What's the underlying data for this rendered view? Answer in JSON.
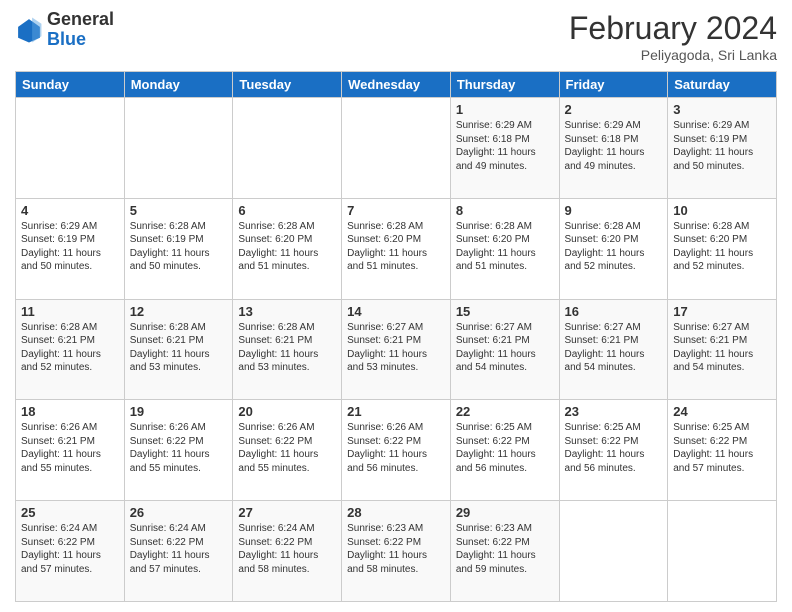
{
  "header": {
    "logo_general": "General",
    "logo_blue": "Blue",
    "month_title": "February 2024",
    "location": "Peliyagoda, Sri Lanka"
  },
  "weekdays": [
    "Sunday",
    "Monday",
    "Tuesday",
    "Wednesday",
    "Thursday",
    "Friday",
    "Saturday"
  ],
  "weeks": [
    [
      {
        "day": "",
        "info": ""
      },
      {
        "day": "",
        "info": ""
      },
      {
        "day": "",
        "info": ""
      },
      {
        "day": "",
        "info": ""
      },
      {
        "day": "1",
        "info": "Sunrise: 6:29 AM\nSunset: 6:18 PM\nDaylight: 11 hours and 49 minutes."
      },
      {
        "day": "2",
        "info": "Sunrise: 6:29 AM\nSunset: 6:18 PM\nDaylight: 11 hours and 49 minutes."
      },
      {
        "day": "3",
        "info": "Sunrise: 6:29 AM\nSunset: 6:19 PM\nDaylight: 11 hours and 50 minutes."
      }
    ],
    [
      {
        "day": "4",
        "info": "Sunrise: 6:29 AM\nSunset: 6:19 PM\nDaylight: 11 hours and 50 minutes."
      },
      {
        "day": "5",
        "info": "Sunrise: 6:28 AM\nSunset: 6:19 PM\nDaylight: 11 hours and 50 minutes."
      },
      {
        "day": "6",
        "info": "Sunrise: 6:28 AM\nSunset: 6:20 PM\nDaylight: 11 hours and 51 minutes."
      },
      {
        "day": "7",
        "info": "Sunrise: 6:28 AM\nSunset: 6:20 PM\nDaylight: 11 hours and 51 minutes."
      },
      {
        "day": "8",
        "info": "Sunrise: 6:28 AM\nSunset: 6:20 PM\nDaylight: 11 hours and 51 minutes."
      },
      {
        "day": "9",
        "info": "Sunrise: 6:28 AM\nSunset: 6:20 PM\nDaylight: 11 hours and 52 minutes."
      },
      {
        "day": "10",
        "info": "Sunrise: 6:28 AM\nSunset: 6:20 PM\nDaylight: 11 hours and 52 minutes."
      }
    ],
    [
      {
        "day": "11",
        "info": "Sunrise: 6:28 AM\nSunset: 6:21 PM\nDaylight: 11 hours and 52 minutes."
      },
      {
        "day": "12",
        "info": "Sunrise: 6:28 AM\nSunset: 6:21 PM\nDaylight: 11 hours and 53 minutes."
      },
      {
        "day": "13",
        "info": "Sunrise: 6:28 AM\nSunset: 6:21 PM\nDaylight: 11 hours and 53 minutes."
      },
      {
        "day": "14",
        "info": "Sunrise: 6:27 AM\nSunset: 6:21 PM\nDaylight: 11 hours and 53 minutes."
      },
      {
        "day": "15",
        "info": "Sunrise: 6:27 AM\nSunset: 6:21 PM\nDaylight: 11 hours and 54 minutes."
      },
      {
        "day": "16",
        "info": "Sunrise: 6:27 AM\nSunset: 6:21 PM\nDaylight: 11 hours and 54 minutes."
      },
      {
        "day": "17",
        "info": "Sunrise: 6:27 AM\nSunset: 6:21 PM\nDaylight: 11 hours and 54 minutes."
      }
    ],
    [
      {
        "day": "18",
        "info": "Sunrise: 6:26 AM\nSunset: 6:21 PM\nDaylight: 11 hours and 55 minutes."
      },
      {
        "day": "19",
        "info": "Sunrise: 6:26 AM\nSunset: 6:22 PM\nDaylight: 11 hours and 55 minutes."
      },
      {
        "day": "20",
        "info": "Sunrise: 6:26 AM\nSunset: 6:22 PM\nDaylight: 11 hours and 55 minutes."
      },
      {
        "day": "21",
        "info": "Sunrise: 6:26 AM\nSunset: 6:22 PM\nDaylight: 11 hours and 56 minutes."
      },
      {
        "day": "22",
        "info": "Sunrise: 6:25 AM\nSunset: 6:22 PM\nDaylight: 11 hours and 56 minutes."
      },
      {
        "day": "23",
        "info": "Sunrise: 6:25 AM\nSunset: 6:22 PM\nDaylight: 11 hours and 56 minutes."
      },
      {
        "day": "24",
        "info": "Sunrise: 6:25 AM\nSunset: 6:22 PM\nDaylight: 11 hours and 57 minutes."
      }
    ],
    [
      {
        "day": "25",
        "info": "Sunrise: 6:24 AM\nSunset: 6:22 PM\nDaylight: 11 hours and 57 minutes."
      },
      {
        "day": "26",
        "info": "Sunrise: 6:24 AM\nSunset: 6:22 PM\nDaylight: 11 hours and 57 minutes."
      },
      {
        "day": "27",
        "info": "Sunrise: 6:24 AM\nSunset: 6:22 PM\nDaylight: 11 hours and 58 minutes."
      },
      {
        "day": "28",
        "info": "Sunrise: 6:23 AM\nSunset: 6:22 PM\nDaylight: 11 hours and 58 minutes."
      },
      {
        "day": "29",
        "info": "Sunrise: 6:23 AM\nSunset: 6:22 PM\nDaylight: 11 hours and 59 minutes."
      },
      {
        "day": "",
        "info": ""
      },
      {
        "day": "",
        "info": ""
      }
    ]
  ]
}
